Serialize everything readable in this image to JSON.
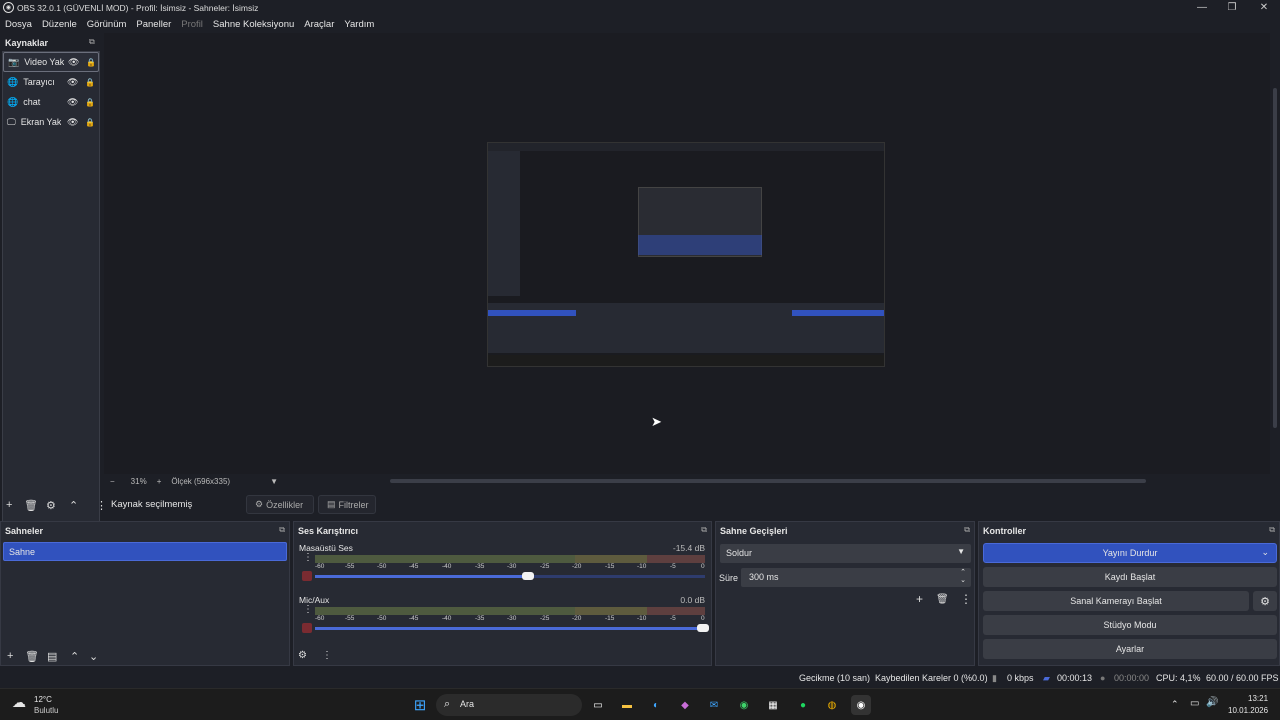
{
  "window": {
    "title": "OBS 32.0.1 (GÜVENLİ MOD) - Profil: İsimsiz - Sahneler: İsimsiz"
  },
  "menu": [
    "Dosya",
    "Düzenle",
    "Görünüm",
    "Paneller",
    "Profil",
    "Sahne Koleksiyonu",
    "Araçlar",
    "Yardım"
  ],
  "sources": {
    "title": "Kaynaklar",
    "items": [
      {
        "label": "Video Yak",
        "icon": "camera-icon"
      },
      {
        "label": "Tarayıcı",
        "icon": "globe-icon"
      },
      {
        "label": "chat",
        "icon": "globe-icon"
      },
      {
        "label": "Ekran Yak",
        "icon": "monitor-icon"
      }
    ]
  },
  "zoom": {
    "minus": "−",
    "value": "31%",
    "plus": "+",
    "scale": "Ölçek (596x335)"
  },
  "context": {
    "no_selection": "Kaynak seçilmemiş",
    "properties": "Özellikler",
    "filters": "Filtreler"
  },
  "scenes": {
    "title": "Sahneler",
    "items": [
      "Sahne"
    ]
  },
  "mixer": {
    "title": "Ses Karıştırıcı",
    "ticks": [
      "-60",
      "-55",
      "-50",
      "-45",
      "-40",
      "-35",
      "-30",
      "-25",
      "-20",
      "-15",
      "-10",
      "-5",
      "0"
    ],
    "channels": [
      {
        "name": "Masaüstü Ses",
        "db": "-15.4 dB",
        "volume": 0.55
      },
      {
        "name": "Mic/Aux",
        "db": "0.0 dB",
        "volume": 1.0
      }
    ]
  },
  "transitions": {
    "title": "Sahne Geçişleri",
    "selected": "Soldur",
    "duration_label": "Süre",
    "duration": "300 ms"
  },
  "controls": {
    "title": "Kontroller",
    "stream": "Yayını Durdur",
    "record": "Kaydı Başlat",
    "virtualcam": "Sanal Kamerayı Başlat",
    "studio": "Stüdyo Modu",
    "settings": "Ayarlar"
  },
  "status": {
    "delay": "Gecikme (10 san)",
    "dropped": "Kaybedilen Kareler 0 (%0.0)",
    "kbps": "0 kbps",
    "stream_time": "00:00:13",
    "rec_time": "00:00:00",
    "cpu": "CPU: 4,1%",
    "fps": "60.00 / 60.00 FPS"
  },
  "taskbar": {
    "weather_temp": "12°C",
    "weather_desc": "Bulutlu",
    "search": "Ara",
    "time": "13:21",
    "date": "10.01.2026"
  },
  "colors": {
    "accent": "#3152be",
    "bg": "#1d1f26",
    "panel": "#272a33"
  }
}
